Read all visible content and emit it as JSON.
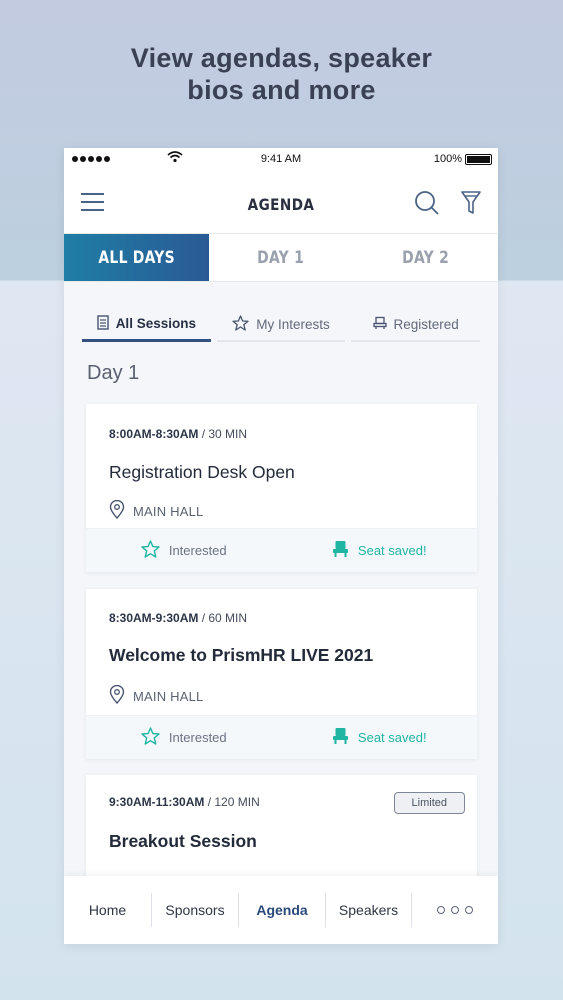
{
  "headline": {
    "line1": "View agendas, speaker",
    "line2": "bios and more"
  },
  "status_bar": {
    "time": "9:41 AM",
    "battery": "100%"
  },
  "header": {
    "title": "AGENDA",
    "menu_icon": "hamburger-icon",
    "search_icon": "search-icon",
    "filter_icon": "filter-icon"
  },
  "day_tabs": [
    {
      "label": "ALL DAYS",
      "active": true
    },
    {
      "label": "DAY 1",
      "active": false
    },
    {
      "label": "DAY 2",
      "active": false
    }
  ],
  "session_filters": [
    {
      "label": "All Sessions",
      "icon": "calendar-icon",
      "active": true
    },
    {
      "label": "My Interests",
      "icon": "star-icon",
      "active": false
    },
    {
      "label": "Registered",
      "icon": "seat-icon",
      "active": false
    }
  ],
  "day_label": "Day 1",
  "sessions": [
    {
      "time": "8:00AM-8:30AM",
      "duration": "/ 30 MIN",
      "title": "Registration Desk Open",
      "location": "MAIN HALL",
      "interested_label": "Interested",
      "seat_label": "Seat saved!"
    },
    {
      "time": "8:30AM-9:30AM",
      "duration": "/ 60 MIN",
      "title": "Welcome to PrismHR LIVE 2021",
      "location": "MAIN HALL",
      "interested_label": "Interested",
      "seat_label": "Seat saved!"
    },
    {
      "time": "9:30AM-11:30AM",
      "duration": "/ 120 MIN",
      "title": "Breakout Session",
      "badge": "Limited"
    }
  ],
  "bottom_nav": [
    {
      "label": "Home"
    },
    {
      "label": "Sponsors"
    },
    {
      "label": "Agenda",
      "active": true
    },
    {
      "label": "Speakers"
    }
  ],
  "colors": {
    "accent": "#2b4a7c",
    "tab_gradient_start": "#1f7ea6",
    "tab_gradient_end": "#2a5a94",
    "seat_saved": "#1fb5a2"
  }
}
